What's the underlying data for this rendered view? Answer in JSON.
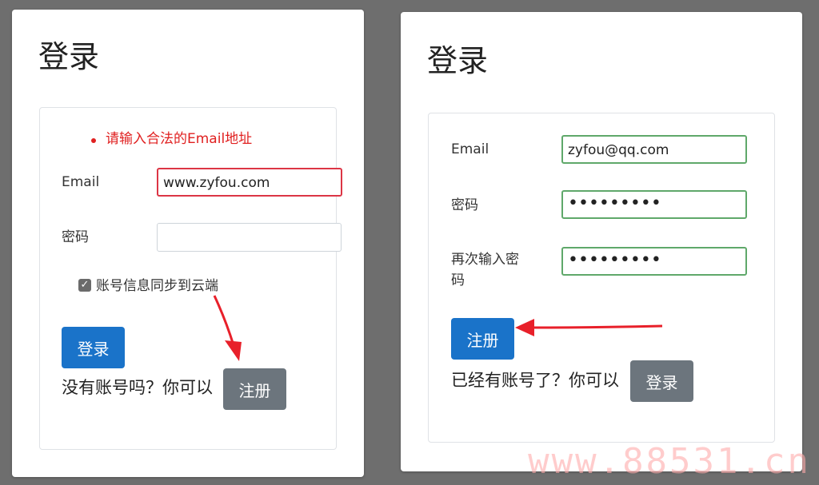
{
  "login": {
    "title": "登录",
    "error": "请输入合法的Email地址",
    "email_label": "Email",
    "email_value": "www.zyfou.com",
    "password_label": "密码",
    "password_value": "",
    "remember_label": "账号信息同步到云端",
    "remember_checked": true,
    "submit_label": "登录",
    "switch_prompt": "没有账号吗？你可以",
    "switch_button": "注册"
  },
  "register": {
    "title": "登录",
    "email_label": "Email",
    "email_value": "zyfou@qq.com",
    "password_label": "密码",
    "password_value": "•••••••••",
    "confirm_label": "再次输入密码",
    "confirm_value": "•••••••••",
    "submit_label": "注册",
    "switch_prompt": "已经有账号了？你可以",
    "switch_button": "登录"
  },
  "annotations": {
    "arrow_color": "#e8202a"
  },
  "watermark": "www.88531.cn"
}
